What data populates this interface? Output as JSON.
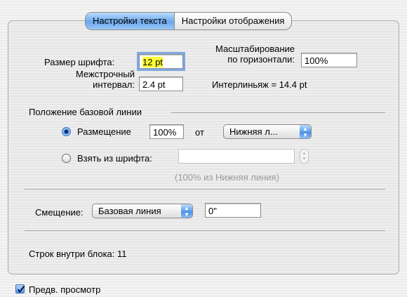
{
  "tabs": [
    {
      "label": "Настройки текста",
      "active": true
    },
    {
      "label": "Настройки отображения",
      "active": false
    }
  ],
  "text_settings": {
    "font_size_label": "Размер шрифта:",
    "font_size_value": "12 pt",
    "line_spacing_label_1": "Межстрочный",
    "line_spacing_label_2": "интервал:",
    "line_spacing_value": "2.4 pt",
    "hscale_label_1": "Масштабирование",
    "hscale_label_2": "по горизонтали:",
    "hscale_value": "100%",
    "leading_text": "Интерлиньяж =  14.4 pt"
  },
  "baseline": {
    "section_title": "Положение базовой линии",
    "placement_label": "Размещение",
    "placement_value": "100%",
    "from_label": "от",
    "from_popup_value": "Нижняя л...",
    "from_font_label": "Взять из шрифта:",
    "from_font_value": "",
    "note": "(100% из Нижняя линия)",
    "selected": "placement"
  },
  "offset": {
    "label": "Смещение:",
    "popup_value": "Базовая линия",
    "value": "0\""
  },
  "lines_in_block": {
    "label": "Строк внутри блока:",
    "value": "11"
  },
  "preview": {
    "label": "Предв. просмотр",
    "checked": true
  },
  "colors": {
    "accent": "#5a9cea",
    "focus_highlight": "#ffff33"
  }
}
